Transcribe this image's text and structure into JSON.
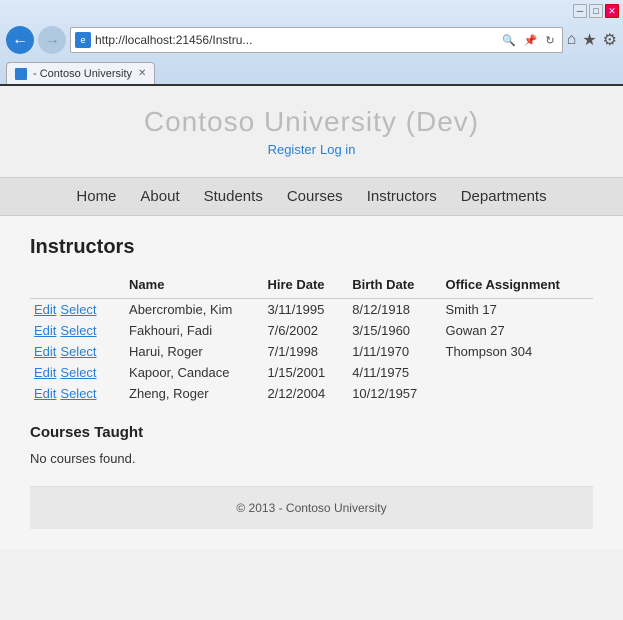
{
  "browser": {
    "title_bar": {
      "minimize_label": "─",
      "maximize_label": "□",
      "close_label": "✕"
    },
    "address": {
      "url": "http://localhost:21456/Instru...",
      "favicon_label": "e"
    },
    "tab": {
      "label": "- Contoso University",
      "favicon_label": "C"
    },
    "nav_icons": {
      "home": "⌂",
      "star": "★",
      "gear": "⚙"
    }
  },
  "site": {
    "title": "Contoso University (Dev)",
    "auth": {
      "register": "Register",
      "login": "Log in"
    },
    "nav": {
      "items": [
        "Home",
        "About",
        "Students",
        "Courses",
        "Instructors",
        "Departments"
      ]
    }
  },
  "page": {
    "heading": "Instructors",
    "table": {
      "columns": [
        "",
        "Name",
        "Hire Date",
        "Birth Date",
        "Office Assignment"
      ],
      "rows": [
        {
          "name": "Abercrombie, Kim",
          "hire_date": "3/11/1995",
          "birth_date": "8/12/1918",
          "office": "Smith 17"
        },
        {
          "name": "Fakhouri, Fadi",
          "hire_date": "7/6/2002",
          "birth_date": "3/15/1960",
          "office": "Gowan 27"
        },
        {
          "name": "Harui, Roger",
          "hire_date": "7/1/1998",
          "birth_date": "1/11/1970",
          "office": "Thompson 304"
        },
        {
          "name": "Kapoor, Candace",
          "hire_date": "1/15/2001",
          "birth_date": "4/11/1975",
          "office": ""
        },
        {
          "name": "Zheng, Roger",
          "hire_date": "2/12/2004",
          "birth_date": "10/12/1957",
          "office": ""
        }
      ],
      "edit_label": "Edit",
      "select_label": "Select"
    },
    "courses_section": {
      "heading": "Courses Taught",
      "empty_message": "No courses found."
    },
    "footer": {
      "text": "© 2013 - Contoso University"
    }
  }
}
